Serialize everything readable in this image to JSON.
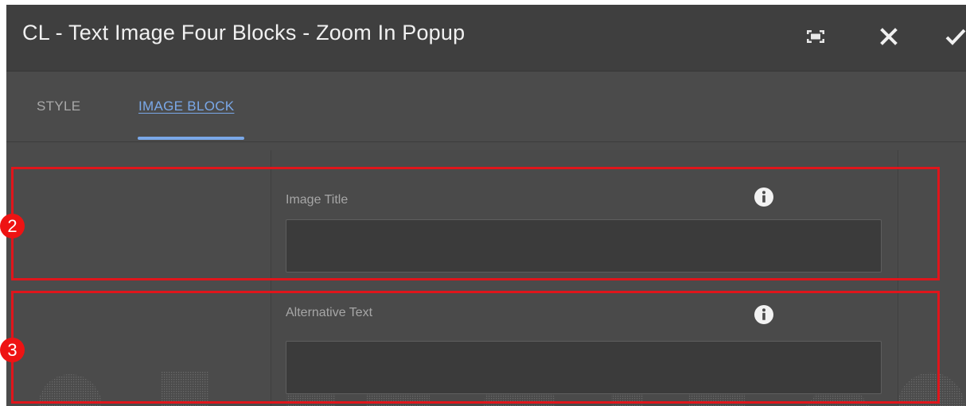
{
  "dialog": {
    "title": "CL - Text Image Four Blocks - Zoom In Popup",
    "actions": {
      "fullscreen_icon": "fullscreen-icon",
      "close_icon": "close-icon",
      "done_icon": "checkmark-icon"
    }
  },
  "tabs": [
    {
      "label": "STYLE",
      "active": false
    },
    {
      "label": "IMAGE BLOCK",
      "active": true
    }
  ],
  "fields": [
    {
      "label": "Image Title",
      "value": "",
      "info_icon": "info-icon"
    },
    {
      "label": "Alternative Text",
      "value": "",
      "info_icon": "info-icon"
    }
  ],
  "annotations": [
    {
      "number": "2",
      "color": "#e0151b"
    },
    {
      "number": "3",
      "color": "#e0151b"
    }
  ],
  "colors": {
    "header_bg": "#3f3f3f",
    "panel_bg": "#4b4b4b",
    "active_tab": "#7aa8e8",
    "annotation_red": "#e0151b"
  }
}
